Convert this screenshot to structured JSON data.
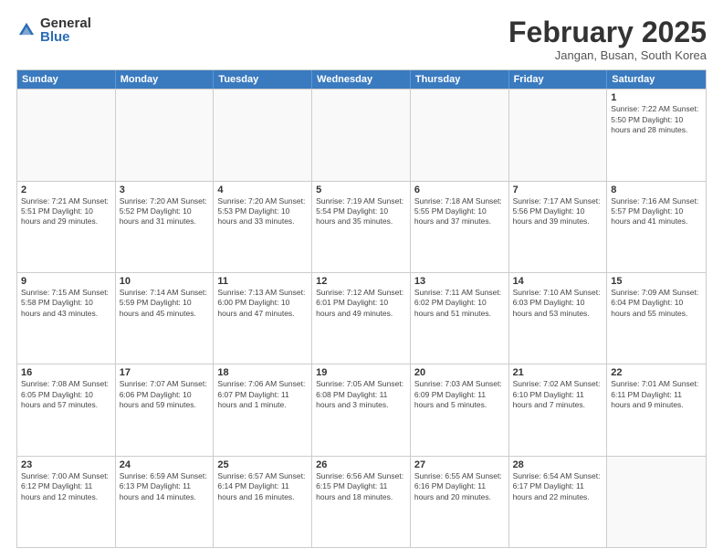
{
  "logo": {
    "general": "General",
    "blue": "Blue"
  },
  "header": {
    "month": "February 2025",
    "location": "Jangan, Busan, South Korea"
  },
  "weekdays": [
    "Sunday",
    "Monday",
    "Tuesday",
    "Wednesday",
    "Thursday",
    "Friday",
    "Saturday"
  ],
  "weeks": [
    [
      {
        "day": "",
        "info": ""
      },
      {
        "day": "",
        "info": ""
      },
      {
        "day": "",
        "info": ""
      },
      {
        "day": "",
        "info": ""
      },
      {
        "day": "",
        "info": ""
      },
      {
        "day": "",
        "info": ""
      },
      {
        "day": "1",
        "info": "Sunrise: 7:22 AM\nSunset: 5:50 PM\nDaylight: 10 hours\nand 28 minutes."
      }
    ],
    [
      {
        "day": "2",
        "info": "Sunrise: 7:21 AM\nSunset: 5:51 PM\nDaylight: 10 hours\nand 29 minutes."
      },
      {
        "day": "3",
        "info": "Sunrise: 7:20 AM\nSunset: 5:52 PM\nDaylight: 10 hours\nand 31 minutes."
      },
      {
        "day": "4",
        "info": "Sunrise: 7:20 AM\nSunset: 5:53 PM\nDaylight: 10 hours\nand 33 minutes."
      },
      {
        "day": "5",
        "info": "Sunrise: 7:19 AM\nSunset: 5:54 PM\nDaylight: 10 hours\nand 35 minutes."
      },
      {
        "day": "6",
        "info": "Sunrise: 7:18 AM\nSunset: 5:55 PM\nDaylight: 10 hours\nand 37 minutes."
      },
      {
        "day": "7",
        "info": "Sunrise: 7:17 AM\nSunset: 5:56 PM\nDaylight: 10 hours\nand 39 minutes."
      },
      {
        "day": "8",
        "info": "Sunrise: 7:16 AM\nSunset: 5:57 PM\nDaylight: 10 hours\nand 41 minutes."
      }
    ],
    [
      {
        "day": "9",
        "info": "Sunrise: 7:15 AM\nSunset: 5:58 PM\nDaylight: 10 hours\nand 43 minutes."
      },
      {
        "day": "10",
        "info": "Sunrise: 7:14 AM\nSunset: 5:59 PM\nDaylight: 10 hours\nand 45 minutes."
      },
      {
        "day": "11",
        "info": "Sunrise: 7:13 AM\nSunset: 6:00 PM\nDaylight: 10 hours\nand 47 minutes."
      },
      {
        "day": "12",
        "info": "Sunrise: 7:12 AM\nSunset: 6:01 PM\nDaylight: 10 hours\nand 49 minutes."
      },
      {
        "day": "13",
        "info": "Sunrise: 7:11 AM\nSunset: 6:02 PM\nDaylight: 10 hours\nand 51 minutes."
      },
      {
        "day": "14",
        "info": "Sunrise: 7:10 AM\nSunset: 6:03 PM\nDaylight: 10 hours\nand 53 minutes."
      },
      {
        "day": "15",
        "info": "Sunrise: 7:09 AM\nSunset: 6:04 PM\nDaylight: 10 hours\nand 55 minutes."
      }
    ],
    [
      {
        "day": "16",
        "info": "Sunrise: 7:08 AM\nSunset: 6:05 PM\nDaylight: 10 hours\nand 57 minutes."
      },
      {
        "day": "17",
        "info": "Sunrise: 7:07 AM\nSunset: 6:06 PM\nDaylight: 10 hours\nand 59 minutes."
      },
      {
        "day": "18",
        "info": "Sunrise: 7:06 AM\nSunset: 6:07 PM\nDaylight: 11 hours\nand 1 minute."
      },
      {
        "day": "19",
        "info": "Sunrise: 7:05 AM\nSunset: 6:08 PM\nDaylight: 11 hours\nand 3 minutes."
      },
      {
        "day": "20",
        "info": "Sunrise: 7:03 AM\nSunset: 6:09 PM\nDaylight: 11 hours\nand 5 minutes."
      },
      {
        "day": "21",
        "info": "Sunrise: 7:02 AM\nSunset: 6:10 PM\nDaylight: 11 hours\nand 7 minutes."
      },
      {
        "day": "22",
        "info": "Sunrise: 7:01 AM\nSunset: 6:11 PM\nDaylight: 11 hours\nand 9 minutes."
      }
    ],
    [
      {
        "day": "23",
        "info": "Sunrise: 7:00 AM\nSunset: 6:12 PM\nDaylight: 11 hours\nand 12 minutes."
      },
      {
        "day": "24",
        "info": "Sunrise: 6:59 AM\nSunset: 6:13 PM\nDaylight: 11 hours\nand 14 minutes."
      },
      {
        "day": "25",
        "info": "Sunrise: 6:57 AM\nSunset: 6:14 PM\nDaylight: 11 hours\nand 16 minutes."
      },
      {
        "day": "26",
        "info": "Sunrise: 6:56 AM\nSunset: 6:15 PM\nDaylight: 11 hours\nand 18 minutes."
      },
      {
        "day": "27",
        "info": "Sunrise: 6:55 AM\nSunset: 6:16 PM\nDaylight: 11 hours\nand 20 minutes."
      },
      {
        "day": "28",
        "info": "Sunrise: 6:54 AM\nSunset: 6:17 PM\nDaylight: 11 hours\nand 22 minutes."
      },
      {
        "day": "",
        "info": ""
      }
    ]
  ]
}
